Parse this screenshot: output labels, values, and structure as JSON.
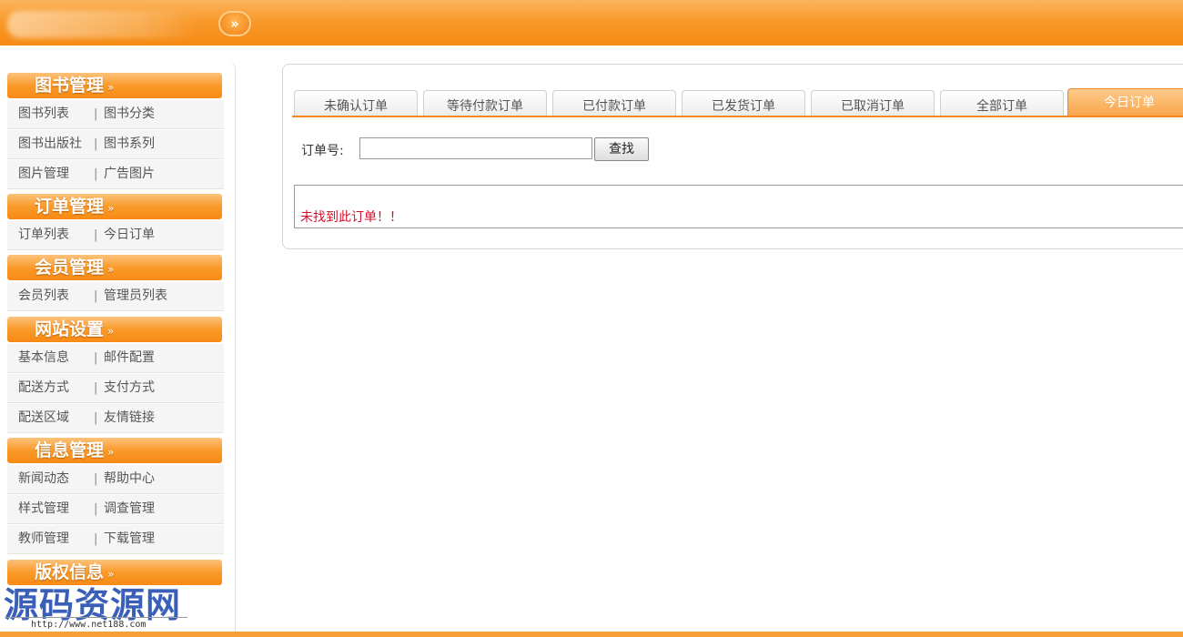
{
  "sidebar": {
    "groups": [
      {
        "title": "图书管理",
        "rows": [
          [
            "图书列表",
            "图书分类"
          ],
          [
            "图书出版社",
            "图书系列"
          ],
          [
            "图片管理",
            "广告图片"
          ]
        ]
      },
      {
        "title": "订单管理",
        "rows": [
          [
            "订单列表",
            "今日订单"
          ]
        ]
      },
      {
        "title": "会员管理",
        "rows": [
          [
            "会员列表",
            "管理员列表"
          ]
        ]
      },
      {
        "title": "网站设置",
        "rows": [
          [
            "基本信息",
            "邮件配置"
          ],
          [
            "配送方式",
            "支付方式"
          ],
          [
            "配送区域",
            "友情链接"
          ]
        ]
      },
      {
        "title": "信息管理",
        "rows": [
          [
            "新闻动态",
            "帮助中心"
          ],
          [
            "样式管理",
            "调查管理"
          ],
          [
            "教师管理",
            "下载管理"
          ]
        ]
      },
      {
        "title": "版权信息",
        "rows": []
      }
    ],
    "separator": "|",
    "chevron": "»"
  },
  "topbar": {
    "toggle_label": "»"
  },
  "tabs": [
    "未确认订单",
    "等待付款订单",
    "已付款订单",
    "已发货订单",
    "已取消订单",
    "全部订单",
    "今日订单"
  ],
  "active_tab": "今日订单",
  "search": {
    "label": "订单号:",
    "value": "",
    "button": "查找"
  },
  "result": {
    "message": "未找到此订单！！"
  },
  "watermark": {
    "text": "源码资源网",
    "url": "http://www.net188.com"
  },
  "colors": {
    "accent": "#f7931e",
    "error": "#d0102a"
  }
}
